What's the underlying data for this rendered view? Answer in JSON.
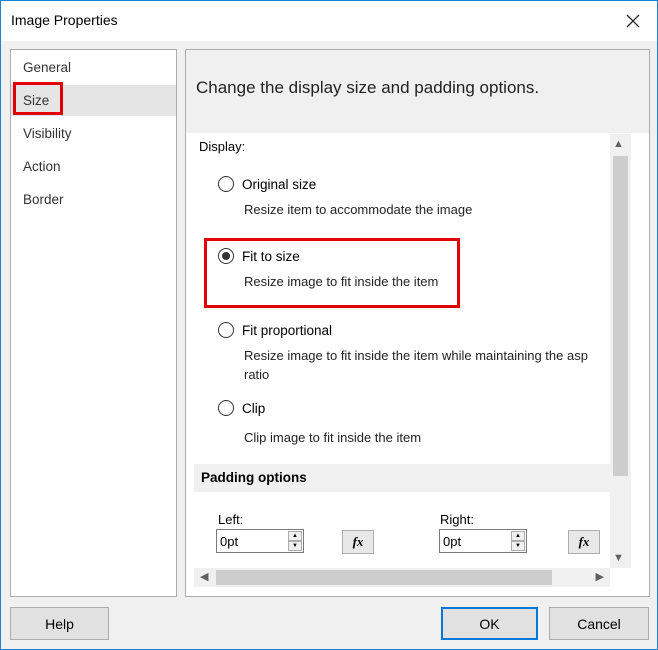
{
  "window": {
    "title": "Image Properties"
  },
  "nav": {
    "items": [
      {
        "label": "General"
      },
      {
        "label": "Size"
      },
      {
        "label": "Visibility"
      },
      {
        "label": "Action"
      },
      {
        "label": "Border"
      }
    ],
    "selected": "Size"
  },
  "panel": {
    "heading": "Change the display size and padding options.",
    "display_label": "Display:",
    "options": [
      {
        "label": "Original size",
        "description": "Resize item to accommodate the image",
        "selected": false
      },
      {
        "label": "Fit to size",
        "description": "Resize image to fit inside the item",
        "selected": true
      },
      {
        "label": "Fit proportional",
        "description": "Resize image to fit inside the item while maintaining the asp",
        "description2": "ratio",
        "selected": false
      },
      {
        "label": "Clip",
        "description": "Clip image to fit inside the item",
        "selected": false
      }
    ],
    "padding": {
      "header": "Padding options",
      "left_label": "Left:",
      "left_value": "0pt",
      "right_label": "Right:",
      "right_value": "0pt",
      "fx_label": "fx"
    }
  },
  "buttons": {
    "help": "Help",
    "ok": "OK",
    "cancel": "Cancel"
  },
  "colors": {
    "highlight_box": "#e00000",
    "accent": "#0078d7",
    "selected_nav": "#e5e5e5"
  },
  "icons": {
    "close": "close-icon",
    "radio_selected": "radio-selected-icon",
    "radio_empty": "radio-empty-icon"
  }
}
